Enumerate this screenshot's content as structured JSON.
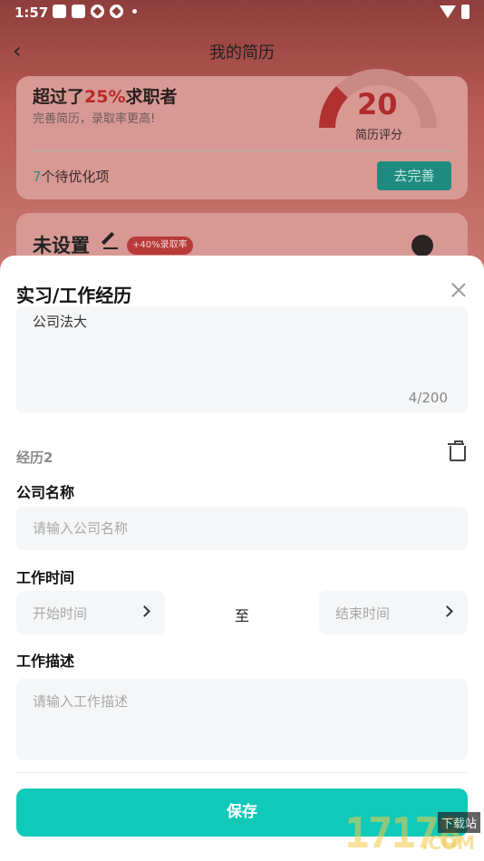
{
  "status_bar": {
    "time": "1:57"
  },
  "header": {
    "title": "我的简历",
    "back_icon": "chevron-left-icon"
  },
  "score_card": {
    "headline_prefix": "超过了",
    "headline_percent": "25%",
    "headline_suffix": "求职者",
    "subtitle": "完善简历，录取率更高!",
    "score": "20",
    "score_label": "简历评分",
    "todo_count": "7",
    "todo_text": "个待优化项",
    "improve_button": "去完善"
  },
  "profile_card": {
    "name": "未设置",
    "badge": "+40%录取率"
  },
  "sheet": {
    "title": "实习/工作经历",
    "description_text": "公司法大",
    "counter": "4/200",
    "experience_label": "经历2",
    "company_label": "公司名称",
    "company_placeholder": "请输入公司名称",
    "time_label": "工作时间",
    "start_placeholder": "开始时间",
    "to_text": "至",
    "end_placeholder": "结束时间",
    "desc_label": "工作描述",
    "desc_placeholder": "请输入工作描述",
    "save_button": "保存"
  },
  "watermark": {
    "digits": "17178",
    "tag": "下载站",
    "suffix": ".COM"
  },
  "colors": {
    "accent": "#11c9b8",
    "danger": "#b82a2a"
  }
}
